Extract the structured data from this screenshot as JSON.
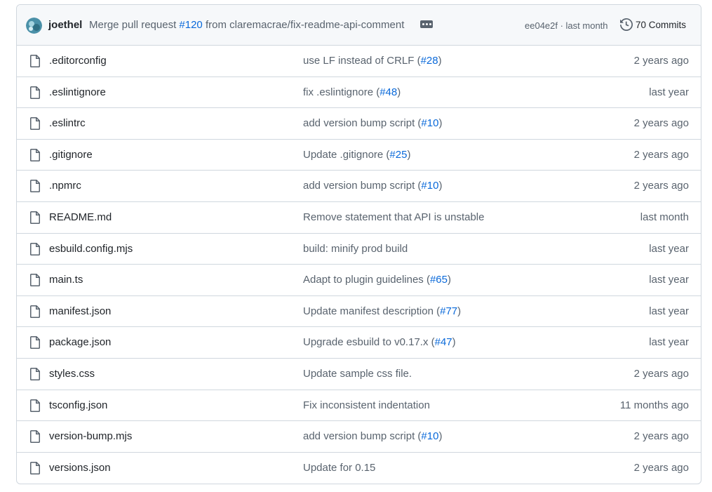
{
  "latest_commit": {
    "author": "joethel",
    "message_prefix": "Merge pull request ",
    "pr_link": "#120",
    "message_suffix": " from claremacrae/fix-readme-api-comment",
    "sha_time": "ee04e2f · last month",
    "commits_label": "70 Commits"
  },
  "files": [
    {
      "name": ".editorconfig",
      "msg": "use LF instead of CRLF (",
      "ref": "#28",
      "end": ")",
      "age": "2 years ago"
    },
    {
      "name": ".eslintignore",
      "msg": "fix .eslintignore (",
      "ref": "#48",
      "end": ")",
      "age": "last year"
    },
    {
      "name": ".eslintrc",
      "msg": "add version bump script (",
      "ref": "#10",
      "end": ")",
      "age": "2 years ago"
    },
    {
      "name": ".gitignore",
      "msg": "Update .gitignore (",
      "ref": "#25",
      "end": ")",
      "age": "2 years ago"
    },
    {
      "name": ".npmrc",
      "msg": "add version bump script (",
      "ref": "#10",
      "end": ")",
      "age": "2 years ago"
    },
    {
      "name": "README.md",
      "msg": "Remove statement that API is unstable",
      "ref": "",
      "end": "",
      "age": "last month"
    },
    {
      "name": "esbuild.config.mjs",
      "msg": "build: minify prod build",
      "ref": "",
      "end": "",
      "age": "last year"
    },
    {
      "name": "main.ts",
      "msg": "Adapt to plugin guidelines (",
      "ref": "#65",
      "end": ")",
      "age": "last year"
    },
    {
      "name": "manifest.json",
      "msg": "Update manifest description (",
      "ref": "#77",
      "end": ")",
      "age": "last year"
    },
    {
      "name": "package.json",
      "msg": "Upgrade esbuild to v0.17.x (",
      "ref": "#47",
      "end": ")",
      "age": "last year"
    },
    {
      "name": "styles.css",
      "msg": "Update sample css file.",
      "ref": "",
      "end": "",
      "age": "2 years ago"
    },
    {
      "name": "tsconfig.json",
      "msg": "Fix inconsistent indentation",
      "ref": "",
      "end": "",
      "age": "11 months ago"
    },
    {
      "name": "version-bump.mjs",
      "msg": "add version bump script (",
      "ref": "#10",
      "end": ")",
      "age": "2 years ago"
    },
    {
      "name": "versions.json",
      "msg": "Update for 0.15",
      "ref": "",
      "end": "",
      "age": "2 years ago"
    }
  ],
  "colors": {
    "link": "#0969da",
    "muted": "#59636e",
    "border": "#d0d7de",
    "header_bg": "#f6f8fa"
  }
}
